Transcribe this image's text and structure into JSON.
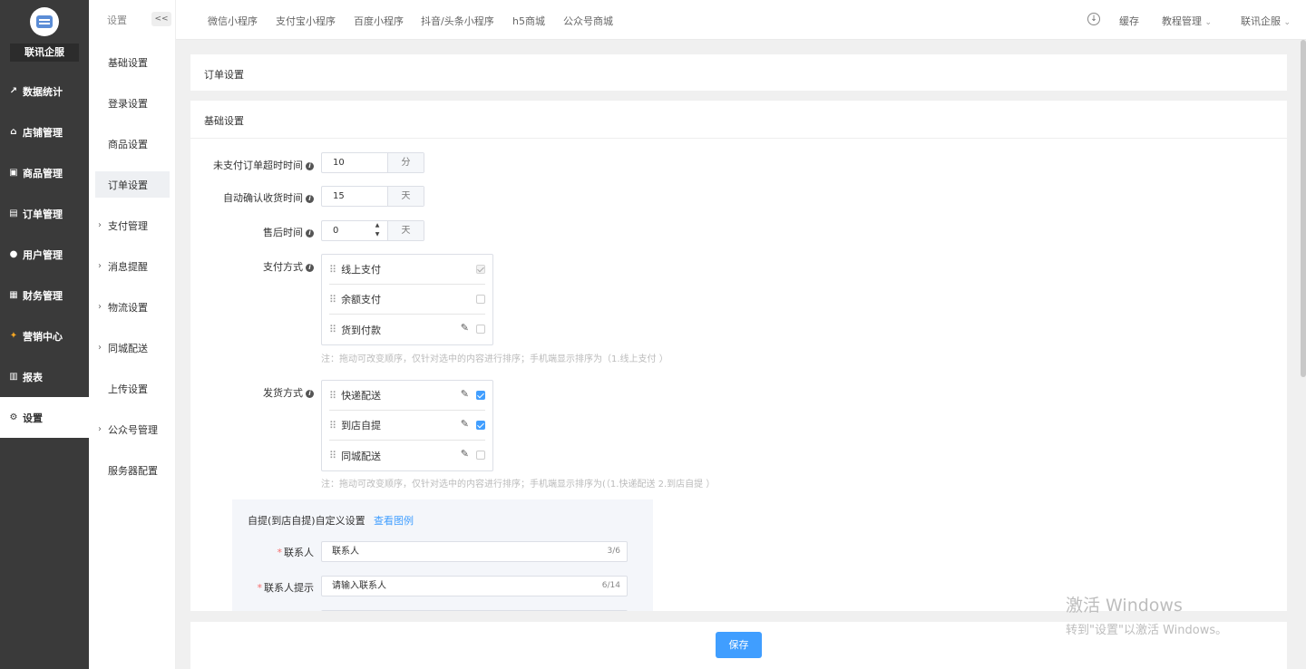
{
  "brand": "联讯企服",
  "nav": [
    {
      "label": "数据统计",
      "icon": "chart-line-icon"
    },
    {
      "label": "店铺管理",
      "icon": "store-icon"
    },
    {
      "label": "商品管理",
      "icon": "goods-icon"
    },
    {
      "label": "订单管理",
      "icon": "order-icon"
    },
    {
      "label": "用户管理",
      "icon": "user-icon"
    },
    {
      "label": "财务管理",
      "icon": "finance-icon"
    },
    {
      "label": "营销中心",
      "icon": "marketing-icon"
    },
    {
      "label": "报表",
      "icon": "bar-chart-icon"
    },
    {
      "label": "设置",
      "icon": "gear-icon"
    }
  ],
  "subnav": {
    "title": "设置",
    "collapse": "<<",
    "items": [
      "基础设置",
      "登录设置",
      "商品设置",
      "订单设置",
      "支付管理",
      "消息提醒",
      "物流设置",
      "同城配送",
      "上传设置",
      "公众号管理",
      "服务器配置"
    ]
  },
  "topbar": {
    "tabs": [
      "微信小程序",
      "支付宝小程序",
      "百度小程序",
      "抖音/头条小程序",
      "h5商城",
      "公众号商城"
    ],
    "cache": "缓存",
    "tutorial": "教程管理",
    "account": "联讯企服"
  },
  "page": {
    "order_settings": "订单设置",
    "basic_settings": "基础设置"
  },
  "form": {
    "unpaid_label": "未支付订单超时时间",
    "unpaid_value": "10",
    "unpaid_unit": "分",
    "confirm_label": "自动确认收货时间",
    "confirm_value": "15",
    "confirm_unit": "天",
    "aftersale_label": "售后时间",
    "aftersale_value": "0",
    "aftersale_unit": "天",
    "payment_label": "支付方式",
    "payment_items": [
      "线上支付",
      "余额支付",
      "货到付款"
    ],
    "payment_note": "注：拖动可改变顺序，仅针对选中的内容进行排序；手机端显示排序为（1.线上支付 ）",
    "delivery_label": "发货方式",
    "delivery_items": [
      "快递配送",
      "到店自提",
      "同城配送"
    ],
    "delivery_note": "注：拖动可改变顺序，仅针对选中的内容进行排序；手机端显示排序为(（1.快递配送 2.到店自提 ）"
  },
  "custom": {
    "title": "自提(到店自提)自定义设置",
    "link": "查看图例",
    "contact_label": "联系人",
    "contact_value": "联系人",
    "contact_count": "3/6",
    "hint_label": "联系人提示",
    "hint_value": "请输入联系人",
    "hint_count": "6/14"
  },
  "save": "保存",
  "watermark": {
    "line1": "激活 Windows",
    "line2": "转到\"设置\"以激活 Windows。"
  }
}
